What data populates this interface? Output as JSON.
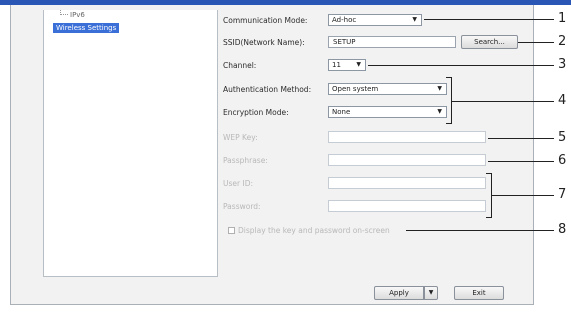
{
  "tree": {
    "ipv6": "IPv6",
    "wireless_settings": "Wireless Settings"
  },
  "form": {
    "communication_mode": {
      "label": "Communication Mode:",
      "value": "Ad-hoc"
    },
    "ssid": {
      "label": "SSID(Network Name):",
      "value": "SETUP",
      "search_button": "Search..."
    },
    "channel": {
      "label": "Channel:",
      "value": "11"
    },
    "authentication_method": {
      "label": "Authentication Method:",
      "value": "Open system"
    },
    "encryption_mode": {
      "label": "Encryption Mode:",
      "value": "None"
    },
    "wep_key": {
      "label": "WEP Key:",
      "value": ""
    },
    "passphrase": {
      "label": "Passphrase:",
      "value": ""
    },
    "user_id": {
      "label": "User ID:",
      "value": ""
    },
    "password": {
      "label": "Password:",
      "value": ""
    },
    "display_checkbox": {
      "label": "Display the key and password on-screen",
      "checked": false
    }
  },
  "buttons": {
    "apply": "Apply",
    "exit": "Exit"
  },
  "callouts": [
    "1",
    "2",
    "3",
    "4",
    "5",
    "6",
    "7",
    "8"
  ],
  "colors": {
    "title_bar": "#2a56b5",
    "selection": "#3a6fd8"
  }
}
